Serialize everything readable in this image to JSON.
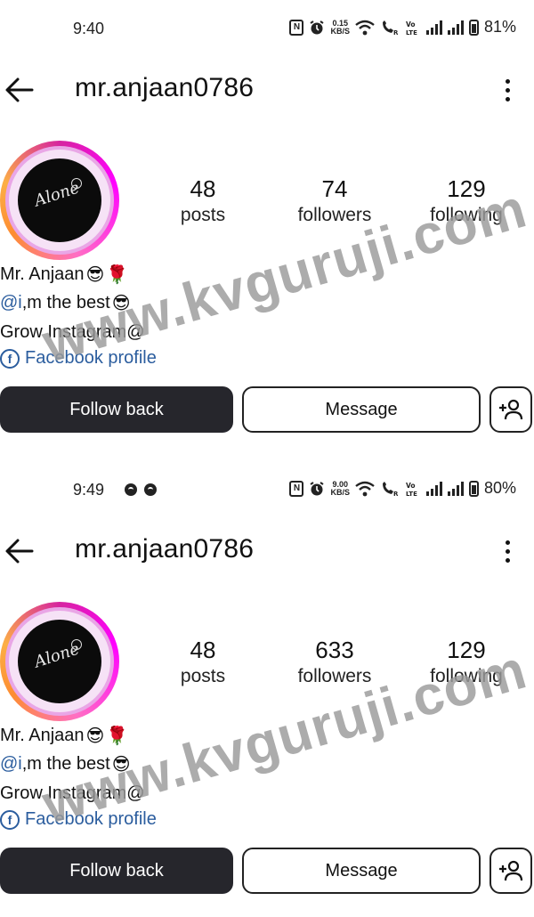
{
  "screens": [
    {
      "status": {
        "time": "9:40",
        "speed_top": "0.15",
        "speed_unit": "KB/S",
        "battery": "81%"
      },
      "header": {
        "username": "mr.anjaan0786"
      },
      "stats": [
        {
          "value": "48",
          "label": "posts"
        },
        {
          "value": "74",
          "label": "followers"
        },
        {
          "value": "129",
          "label": "following"
        }
      ],
      "bio": {
        "name": "Mr. Anjaan",
        "mention": "@i",
        "line2_rest": ",m the best",
        "line3": "Grow Instagram@",
        "link": "Facebook profile"
      },
      "buttons": {
        "follow": "Follow back",
        "message": "Message"
      },
      "watermark": "www.kvguruji.com"
    },
    {
      "status": {
        "time": "9:49",
        "speed_top": "9.00",
        "speed_unit": "KB/S",
        "battery": "80%"
      },
      "header": {
        "username": "mr.anjaan0786"
      },
      "stats": [
        {
          "value": "48",
          "label": "posts"
        },
        {
          "value": "633",
          "label": "followers"
        },
        {
          "value": "129",
          "label": "following"
        }
      ],
      "bio": {
        "name": "Mr. Anjaan",
        "mention": "@i",
        "line2_rest": ",m the best",
        "line3": "Grow Instagram@",
        "link": "Facebook profile"
      },
      "buttons": {
        "follow": "Follow back",
        "message": "Message"
      },
      "watermark": "www.kvguruji.com"
    }
  ],
  "profile_pic_text": "Alone",
  "icons": [
    "nfc-icon",
    "alarm-icon",
    "wifi-icon",
    "wifi-call-icon",
    "volte-icon",
    "signal-icon",
    "battery-icon",
    "back-arrow-icon",
    "more-vert-icon",
    "facebook-icon",
    "add-person-icon",
    "sunglasses-emoji-icon",
    "rose-emoji-icon"
  ],
  "colors": {
    "link": "#2b5d9e",
    "follow_button": "#26262c",
    "watermark": "#9a9a9a"
  }
}
